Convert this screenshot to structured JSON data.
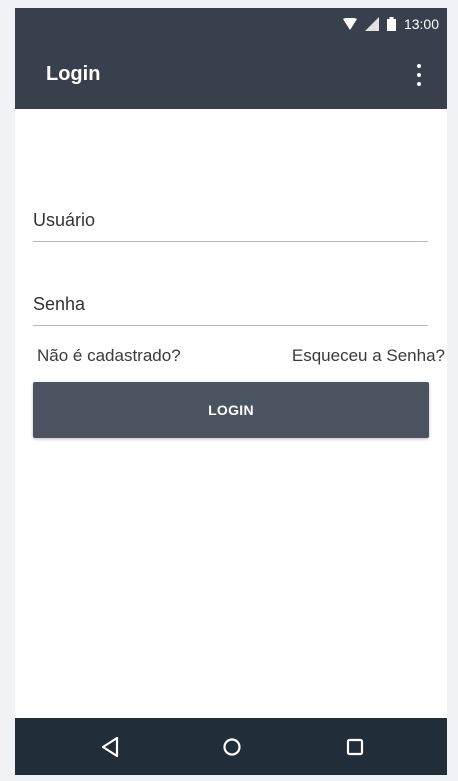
{
  "status_bar": {
    "time": "13:00",
    "icons": [
      "wifi-icon",
      "signal-icon",
      "battery-icon"
    ]
  },
  "app_bar": {
    "title": "Login",
    "menu_icon": "more-vert-icon"
  },
  "form": {
    "username_placeholder": "Usuário",
    "username_value": "",
    "password_placeholder": "Senha",
    "password_value": "",
    "register_link": "Não é cadastrado?",
    "forgot_link": "Esqueceu a Senha?",
    "login_button": "LOGIN"
  },
  "nav_bar": {
    "icons": [
      "back-icon",
      "home-icon",
      "recent-apps-icon"
    ]
  },
  "colors": {
    "app_bar": "#37404c",
    "button": "#4a535f",
    "nav_bar": "#222d3a",
    "field_underline": "#b4b8c8"
  }
}
